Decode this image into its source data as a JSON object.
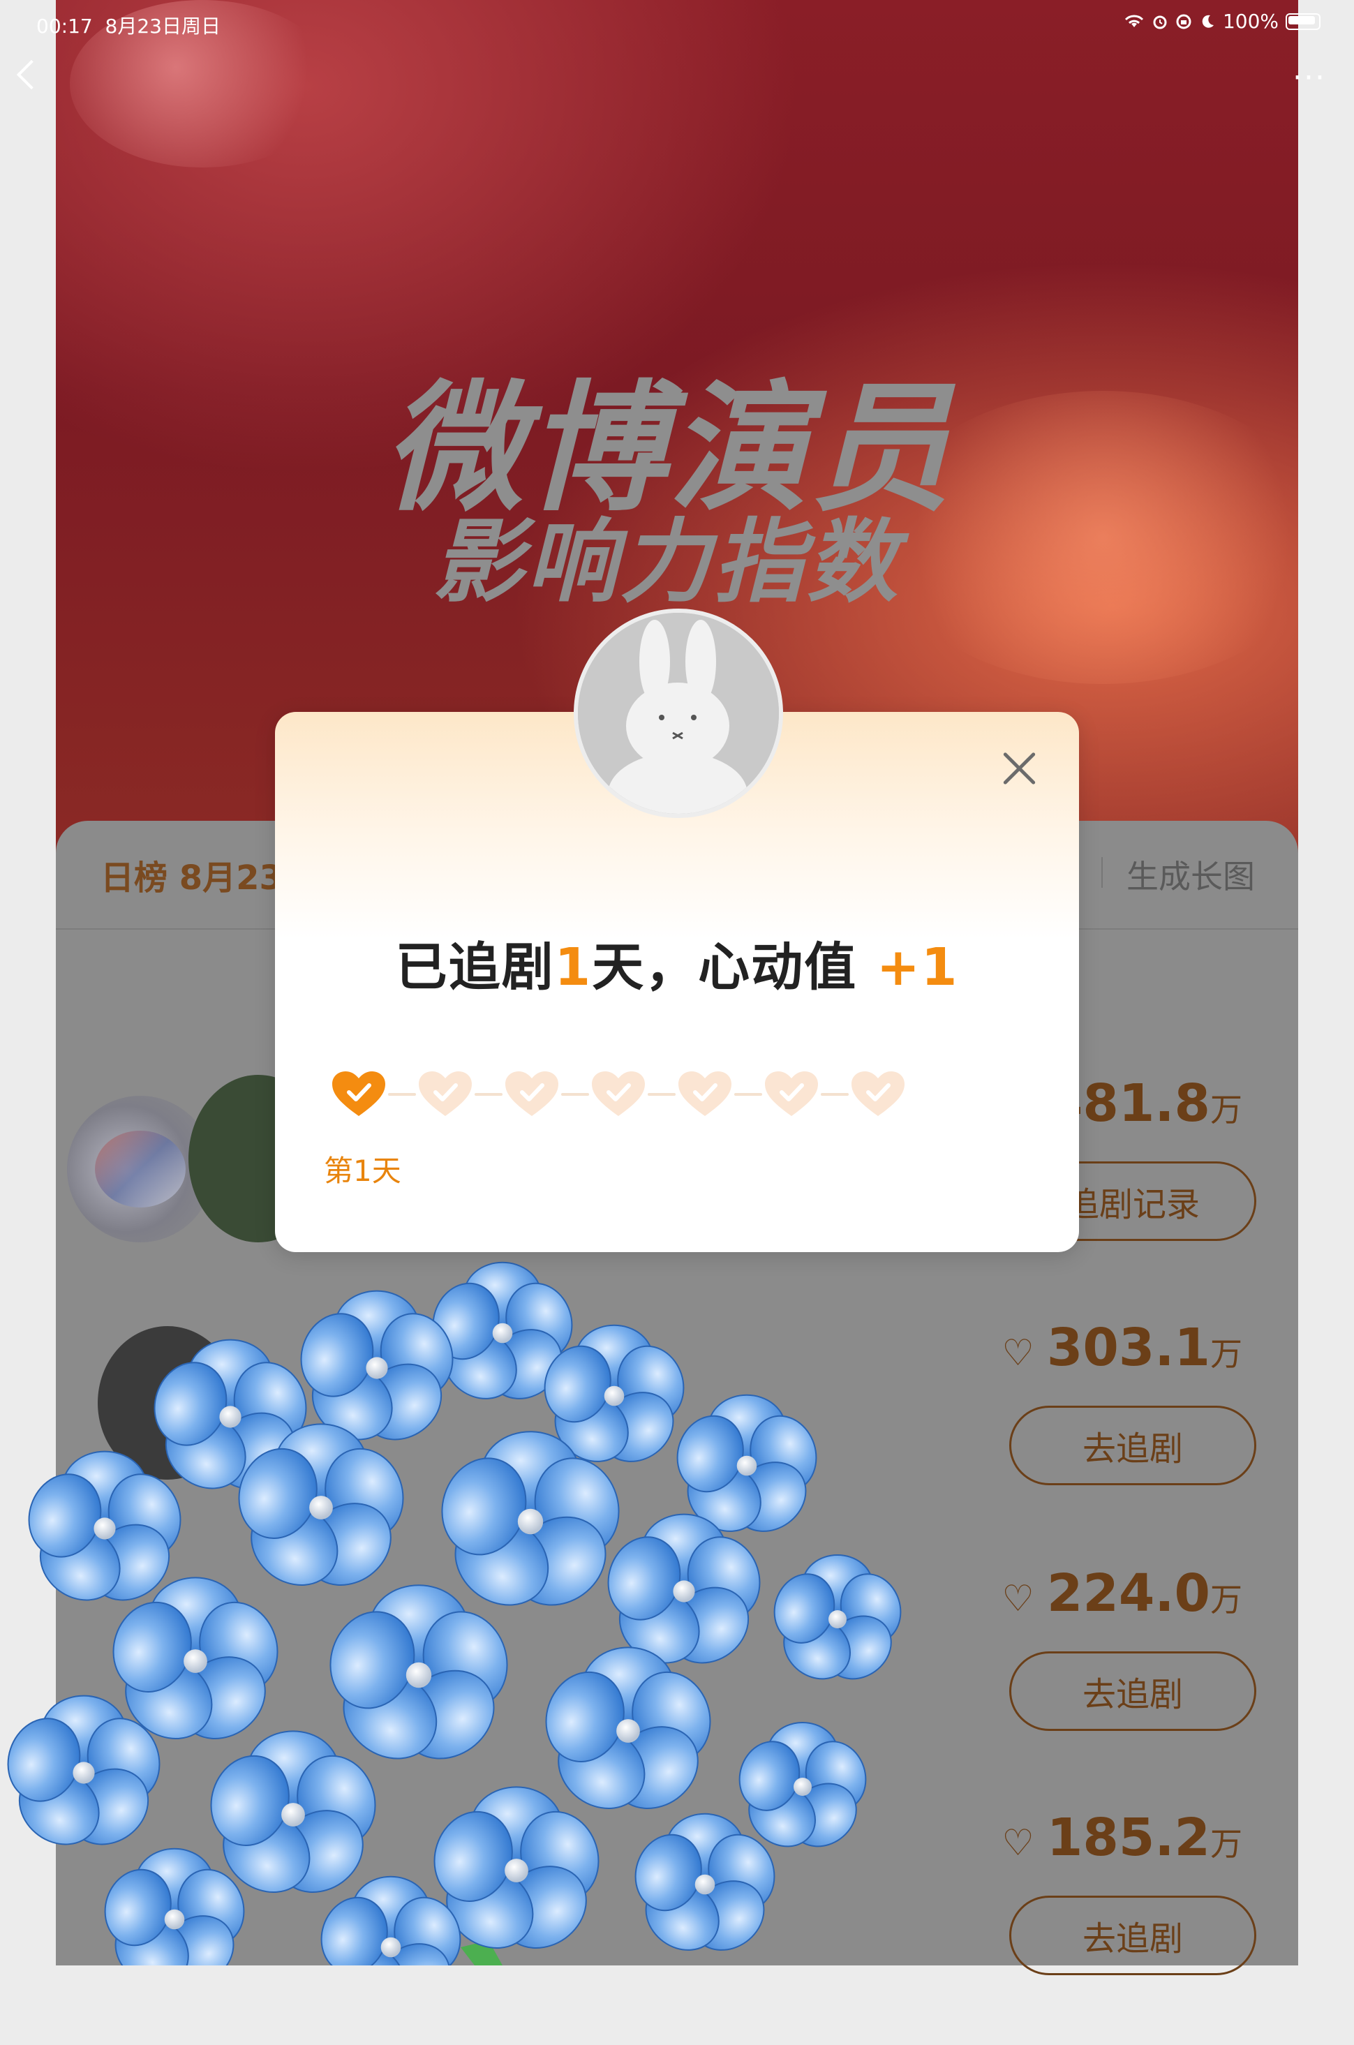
{
  "status_bar": {
    "time": "00:17",
    "date": "8月23日周日",
    "battery": "100%"
  },
  "hero": {
    "title": "微博演员",
    "subtitle": "影响力指数"
  },
  "list": {
    "tab_label": "日榜 8月23",
    "generate_long_image": "生成长图",
    "rows": [
      {
        "score": "481.8",
        "unit": "万",
        "button": "追剧记录"
      },
      {
        "score": "303.1",
        "unit": "万",
        "button": "去追剧"
      },
      {
        "score": "224.0",
        "unit": "万",
        "button": "去追剧"
      },
      {
        "score": "185.2",
        "unit": "万",
        "button": "去追剧"
      }
    ]
  },
  "modal": {
    "msg_prefix": "已追剧",
    "days_count": "1",
    "msg_middle": "天，心动值",
    "plus": "+1",
    "day_label": "第1天",
    "checked_days": 1,
    "total_days": 7
  },
  "colors": {
    "accent": "#f48c10",
    "accent_light": "#fde7c8",
    "heart_inactive": "#fbe5d3"
  }
}
